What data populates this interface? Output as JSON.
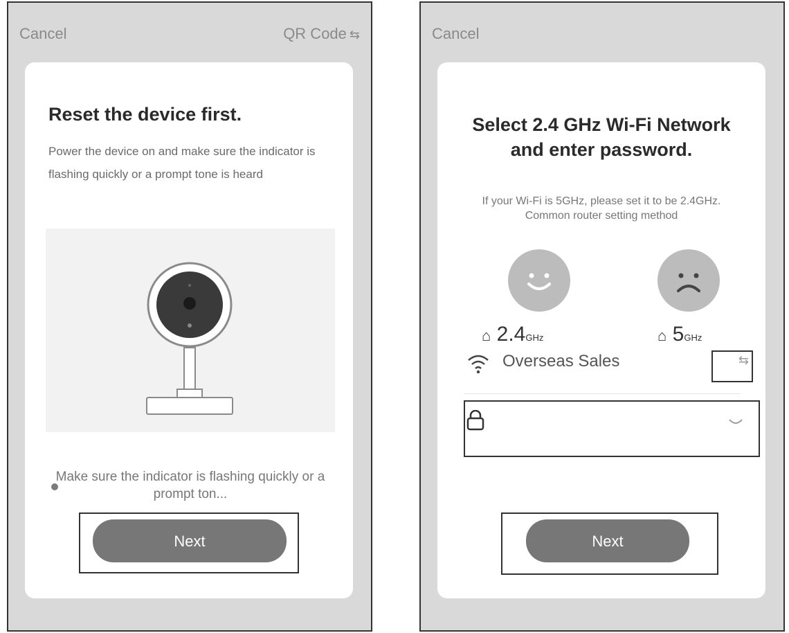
{
  "left": {
    "cancel_label": "Cancel",
    "qr_label": "QR Code",
    "title": "Reset the device first.",
    "description": "Power the device on and make sure the indicator is flashing quickly or a prompt tone is heard",
    "note": "Make sure the indicator is flashing quickly or a prompt ton...",
    "next_label": "Next"
  },
  "right": {
    "cancel_label": "Cancel",
    "title": "Select 2.4 GHz Wi-Fi Network and enter password.",
    "description": "If your Wi-Fi is 5GHz, please set it to be 2.4GHz. Common router setting method",
    "band_24": "2.4",
    "band_5": "5",
    "band_unit": "GHz",
    "ssid": "Overseas Sales",
    "password_value": "",
    "next_label": "Next"
  },
  "colors": {
    "screen_bg": "#d9d9d9",
    "card_bg": "#ffffff",
    "button_bg": "#777777",
    "highlight_border": "#333333"
  },
  "icons": [
    "qr-swap-icon",
    "camera-illustration",
    "radio-dot-icon",
    "smile-face-icon",
    "sad-face-icon",
    "router-icon",
    "wifi-icon",
    "swap-network-icon",
    "lock-icon",
    "eye-hidden-icon"
  ]
}
